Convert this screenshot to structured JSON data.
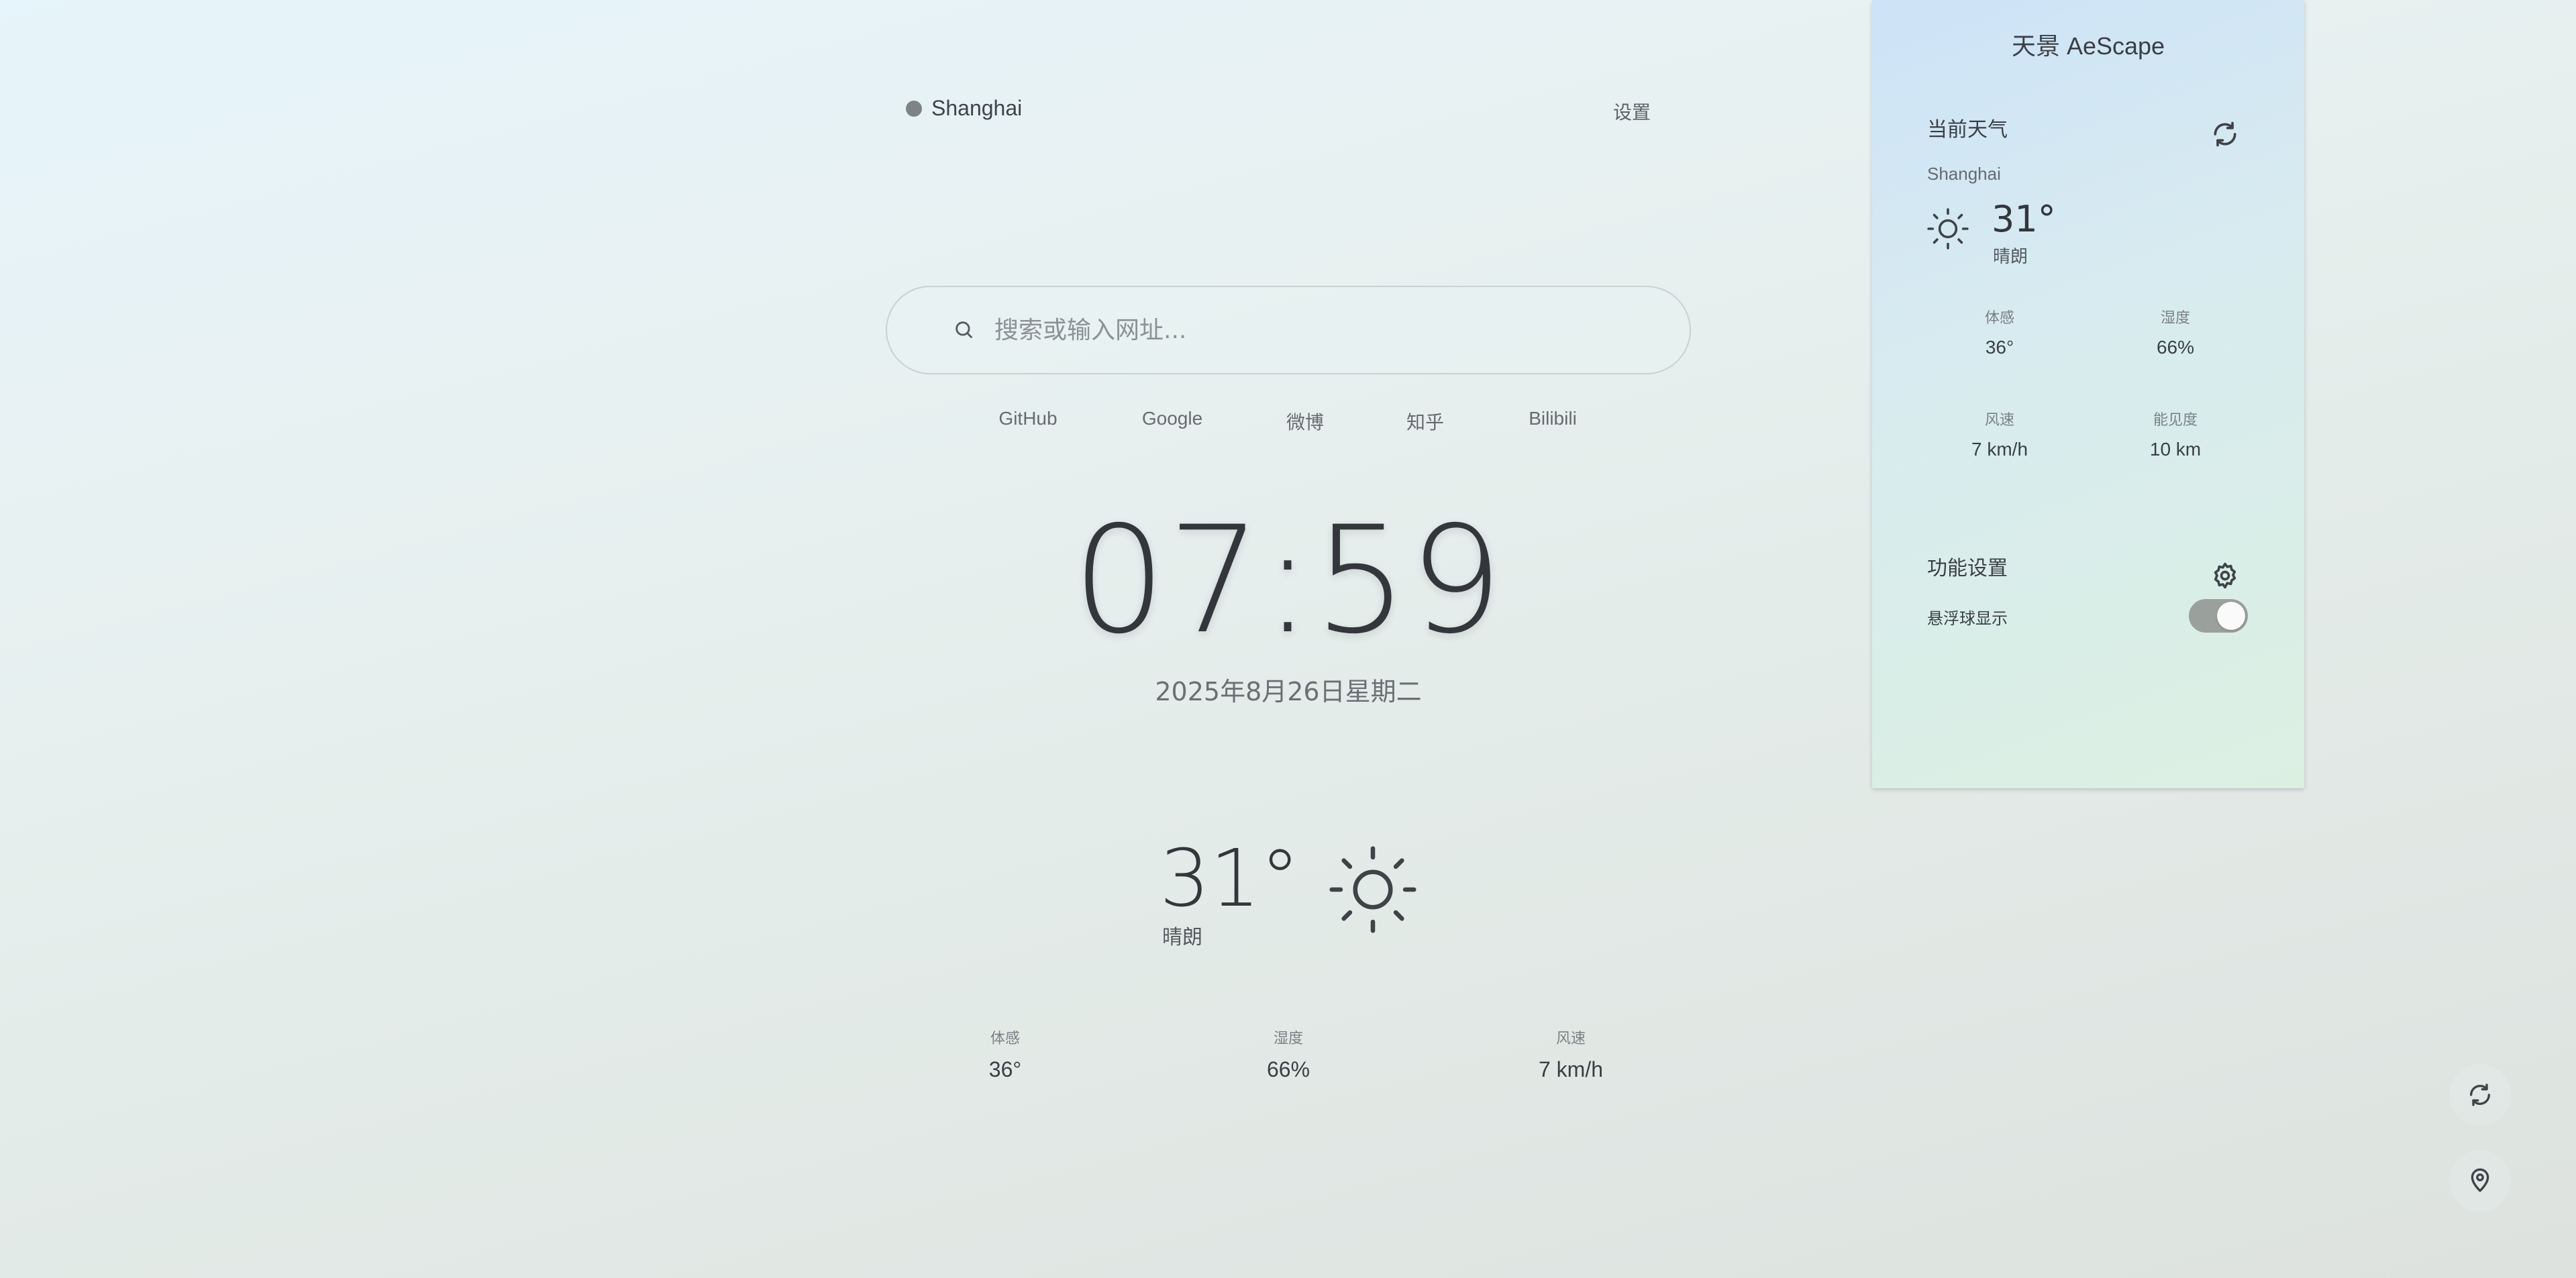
{
  "header": {
    "location": "Shanghai",
    "settings_label": "设置"
  },
  "search": {
    "placeholder": "搜索或输入网址..."
  },
  "quick_links": [
    "GitHub",
    "Google",
    "微博",
    "知乎",
    "Bilibili"
  ],
  "clock": {
    "time": "07:59",
    "date": "2025年8月26日星期二"
  },
  "weather": {
    "temperature": "31°",
    "condition": "晴朗",
    "condition_icon": "sun-icon",
    "metrics": [
      {
        "label": "体感",
        "value": "36°"
      },
      {
        "label": "湿度",
        "value": "66%"
      },
      {
        "label": "风速",
        "value": "7 km/h"
      }
    ]
  },
  "panel": {
    "title": "天景 AeScape",
    "current_heading": "当前天气",
    "city": "Shanghai",
    "temperature": "31°",
    "condition": "晴朗",
    "metrics": [
      {
        "label": "体感",
        "value": "36°"
      },
      {
        "label": "湿度",
        "value": "66%"
      },
      {
        "label": "风速",
        "value": "7 km/h"
      },
      {
        "label": "能见度",
        "value": "10 km"
      }
    ],
    "features_heading": "功能设置",
    "floating_ball_label": "悬浮球显示",
    "floating_ball_enabled": true
  },
  "colors": {
    "accent_text": "#3a3f44",
    "toggle_on": "#9aa09c"
  }
}
